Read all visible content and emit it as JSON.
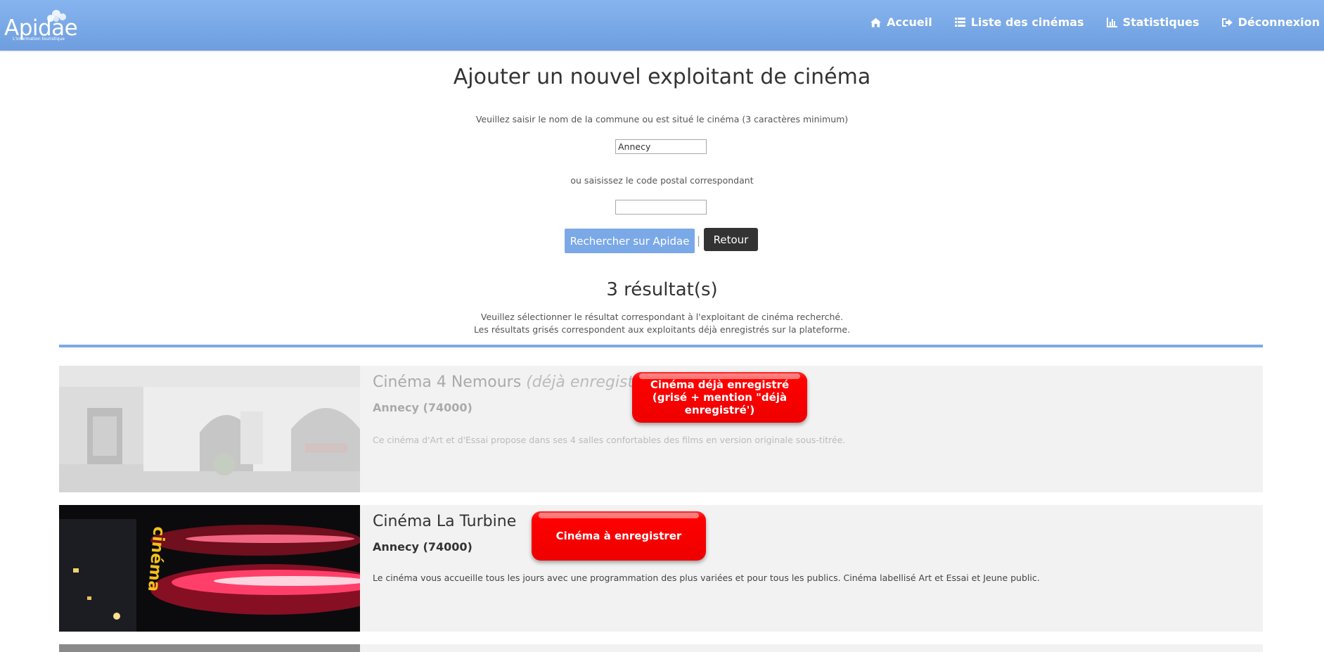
{
  "nav": {
    "logo": "Apidae",
    "logo_tagline": "L'information touristique",
    "items": [
      {
        "label": "Accueil",
        "icon": "home-icon"
      },
      {
        "label": "Liste des cinémas",
        "icon": "list-icon"
      },
      {
        "label": "Statistiques",
        "icon": "bar-chart-icon"
      },
      {
        "label": "Déconnexion",
        "icon": "logout-icon"
      }
    ]
  },
  "form": {
    "title": "Ajouter un nouvel exploitant de cinéma",
    "commune_hint": "Veuillez saisir le nom de la commune ou est situé le cinéma (3 caractères minimum)",
    "commune_value": "Annecy",
    "postal_hint": "ou saisissez le code postal correspondant",
    "postal_value": "",
    "search_label": "Rechercher sur Apidae",
    "separator": "|",
    "back_label": "Retour"
  },
  "results": {
    "title": "3 résultat(s)",
    "hint_line1": "Veuillez sélectionner le résultat correspondant à l'exploitant de cinéma recherché.",
    "hint_line2": "Les résultats grisés correspondent aux exploitants déjà enregistrés sur la plateforme.",
    "items": [
      {
        "name": "Cinéma 4 Nemours",
        "status": "(déjà enregistré)",
        "city": "Annecy (74000)",
        "description": "Ce cinéma d'Art et d'Essai propose dans ses 4 salles confortables des films en version originale sous-titrée.",
        "annotation": "Cinéma déjà enregistré (grisé + mention \"déjà enregistré')",
        "registered": true
      },
      {
        "name": "Cinéma La Turbine",
        "status": "",
        "city": "Annecy (74000)",
        "description": "Le cinéma vous accueille tous les jours avec une programmation des plus variées et pour tous les publics. Cinéma labellisé Art et Essai et Jeune public.",
        "annotation": "Cinéma à enregistrer",
        "sign_text": "cinéma",
        "registered": false
      }
    ]
  },
  "colors": {
    "navbar": "#7aa8ea",
    "accent": "#7ba9e8",
    "annotation": "#ff0000",
    "card_bg": "#f2f2f2"
  }
}
